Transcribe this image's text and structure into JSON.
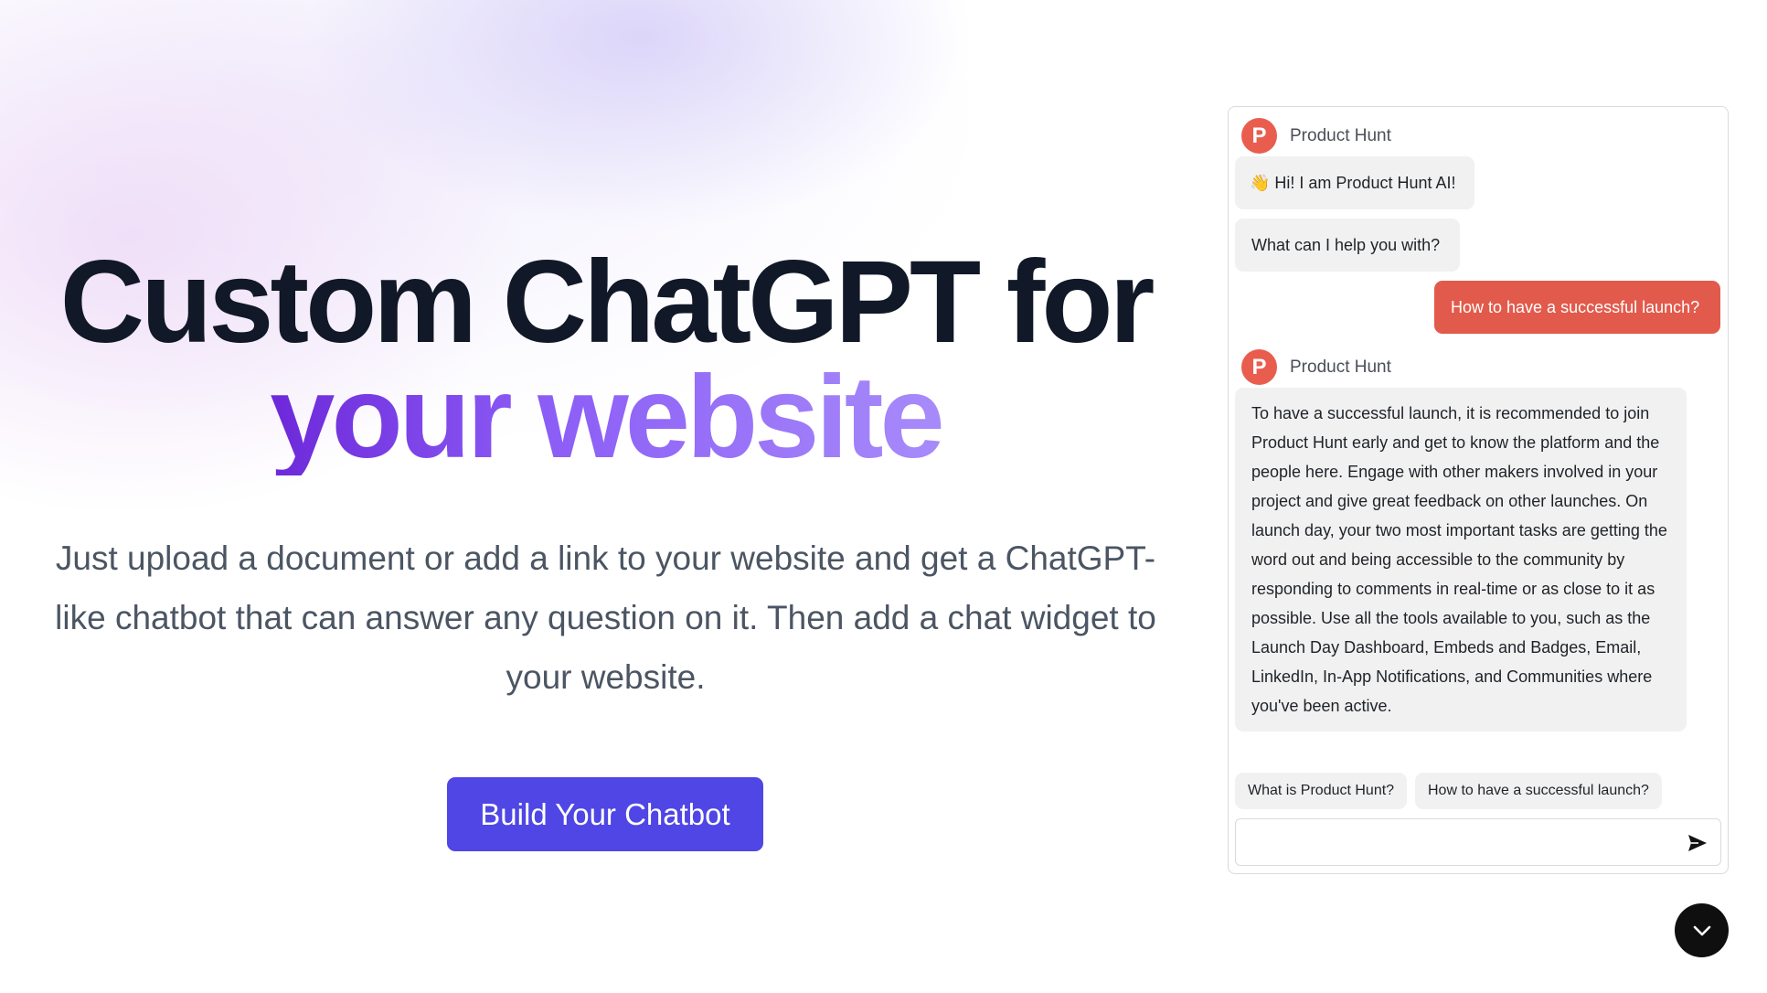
{
  "hero": {
    "title_line1": "Custom ChatGPT for",
    "title_line2": "your website",
    "subtitle": "Just upload a document or add a link to your website and get a ChatGPT-like chatbot that can answer any question on it. Then add a chat widget to your website.",
    "cta_label": "Build Your Chatbot"
  },
  "chat": {
    "bot_name": "Product Hunt",
    "avatar_letter": "P",
    "messages": [
      {
        "role": "bot",
        "text": "👋 Hi! I am Product Hunt AI!"
      },
      {
        "role": "bot",
        "text": "What can I help you with?"
      },
      {
        "role": "user",
        "text": "How to have a successful launch?"
      },
      {
        "role": "bot",
        "text": "To have a successful launch, it is recommended to join Product Hunt early and get to know the platform and the people here. Engage with other makers involved in your project and give great feedback on other launches. On launch day, your two most important tasks are getting the word out and being accessible to the community by responding to comments in real-time or as close to it as possible. Use all the tools available to you, such as the Launch Day Dashboard, Embeds and Badges, Email, LinkedIn, In-App Notifications, and Communities where you've been active."
      }
    ],
    "suggestions": [
      "What is Product Hunt?",
      "How to have a successful launch?"
    ],
    "input_value": "",
    "input_placeholder": ""
  },
  "icons": {
    "send": "send-icon",
    "collapse": "chevron-down-icon"
  },
  "colors": {
    "accent": "#4f46e5",
    "brand": "#e95d4f",
    "title_dark": "#111827",
    "gradient_start": "#6d28d9",
    "gradient_end": "#a78bfa"
  }
}
